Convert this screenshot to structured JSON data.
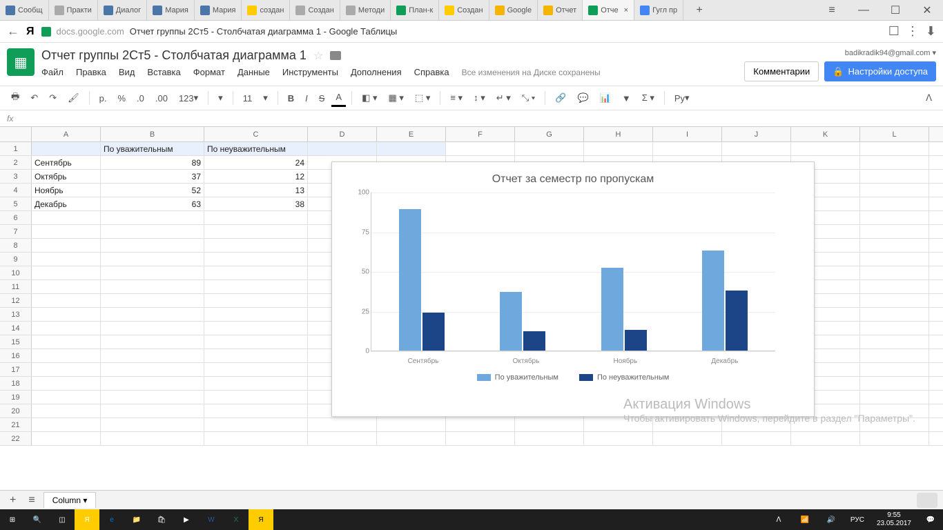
{
  "browser": {
    "tabs": [
      "Сообщ",
      "Практи",
      "Диалог",
      "Мария",
      "Мария",
      "создан",
      "Создан",
      "Методи",
      "План-к",
      "Создан",
      "Google",
      "Отчет",
      "Отче",
      "Гугл пр"
    ],
    "active_tab_index": 12,
    "url_domain": "docs.google.com",
    "url_title": "Отчет группы 2Ст5 - Столбчатая диаграмма 1 - Google Таблицы"
  },
  "sheets": {
    "title": "Отчет группы 2Ст5 - Столбчатая диаграмма 1",
    "user_email": "badikradik94@gmail.com",
    "comments_btn": "Комментарии",
    "share_btn": "Настройки доступа",
    "menus": [
      "Файл",
      "Правка",
      "Вид",
      "Вставка",
      "Формат",
      "Данные",
      "Инструменты",
      "Дополнения",
      "Справка"
    ],
    "save_status": "Все изменения на Диске сохранены",
    "font_size": "11",
    "currency_symbol": "р.",
    "percent": "%",
    "dec_less": ".0",
    "dec_more": ".00",
    "numfmt": "123",
    "lang": "Ру",
    "columns": [
      "A",
      "B",
      "C",
      "D",
      "E",
      "F",
      "G",
      "H",
      "I",
      "J",
      "K",
      "L"
    ],
    "data": {
      "header": [
        "",
        "По уважительным",
        "По неуважительным"
      ],
      "rows": [
        [
          "Сентябрь",
          89,
          24
        ],
        [
          "Октябрь",
          37,
          12
        ],
        [
          "Ноябрь",
          52,
          13
        ],
        [
          "Декабрь",
          63,
          38
        ]
      ]
    },
    "sheet_tab": "Column"
  },
  "chart_data": {
    "type": "bar",
    "title": "Отчет за семестр по пропускам",
    "categories": [
      "Сентябрь",
      "Октябрь",
      "Ноябрь",
      "Декабрь"
    ],
    "series": [
      {
        "name": "По уважительным",
        "values": [
          89,
          37,
          52,
          63
        ],
        "color": "#6fa8dc"
      },
      {
        "name": "По неуважительным",
        "values": [
          24,
          12,
          13,
          38
        ],
        "color": "#1c4587"
      }
    ],
    "ylim": [
      0,
      100
    ],
    "yticks": [
      0,
      25,
      50,
      75,
      100
    ]
  },
  "watermark": {
    "title": "Активация Windows",
    "sub": "Чтобы активировать Windows, перейдите в раздел \"Параметры\"."
  },
  "taskbar": {
    "lang": "РУС",
    "time": "9:55",
    "date": "23.05.2017"
  }
}
